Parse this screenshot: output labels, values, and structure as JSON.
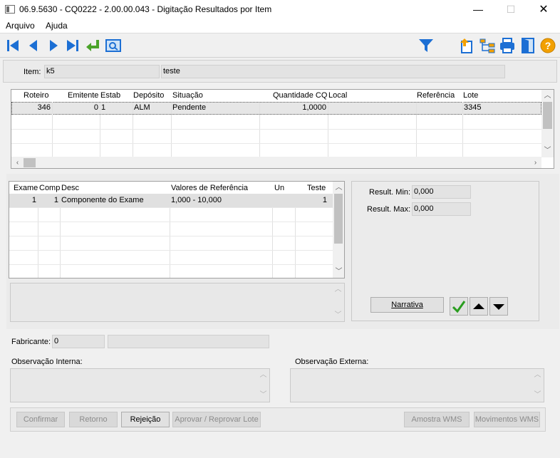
{
  "window": {
    "title": "06.9.5630 - CQ0222 - 2.00.00.043 - Digitação Resultados por Item",
    "minimize": "—",
    "maximize": "☐",
    "close": "✕"
  },
  "menu": {
    "items": [
      "Arquivo",
      "Ajuda"
    ]
  },
  "toolbar": {
    "left_icons": [
      "first-record-icon",
      "previous-record-icon",
      "next-record-icon",
      "last-record-icon",
      "go-to-record-icon",
      "search-icon"
    ],
    "right_icons": [
      "filter-icon",
      "export-icon",
      "hierarchy-icon",
      "print-icon",
      "exit-icon",
      "help-icon"
    ]
  },
  "item": {
    "label": "Item:",
    "code": "k5",
    "description": "teste"
  },
  "main_grid": {
    "columns": [
      "Roteiro",
      "Emitente",
      "Estab",
      "Depósito",
      "Situação",
      "Quantidade CQ",
      "Local",
      "Referência",
      "Lote"
    ],
    "rows": [
      {
        "roteiro": "346",
        "emitente": "0",
        "estab": "1",
        "deposito": "ALM",
        "situacao": "Pendente",
        "quantidade": "1,0000",
        "local": "",
        "referencia": "",
        "lote": "3345"
      }
    ]
  },
  "exam_grid": {
    "columns": [
      "Exame",
      "Comp",
      "Desc",
      "Valores de Referência",
      "Un",
      "Teste"
    ],
    "rows": [
      {
        "exame": "1",
        "comp": "1",
        "desc": "Componente do Exame",
        "valores": "1,000 - 10,000",
        "un": "",
        "teste": "1"
      }
    ]
  },
  "results": {
    "min_label": "Result. Min:",
    "min_value": "0,000",
    "max_label": "Result. Max:",
    "max_value": "0,000",
    "narrativa_label": "Narrativa"
  },
  "fabricante": {
    "label": "Fabricante:",
    "code": "0",
    "name": ""
  },
  "observacao": {
    "interna_label": "Observação Interna:",
    "externa_label": "Observação Externa:"
  },
  "buttons": {
    "confirmar": "Confirmar",
    "retorno": "Retorno",
    "rejeicao": "Rejeição",
    "aprovar": "Aprovar / Reprovar Lote",
    "amostra": "Amostra WMS",
    "movimentos": "Movimentos WMS"
  },
  "colors": {
    "toolbar_blue": "#1c6fd4",
    "check_green": "#2a9d1f",
    "help_orange": "#f2a000"
  }
}
